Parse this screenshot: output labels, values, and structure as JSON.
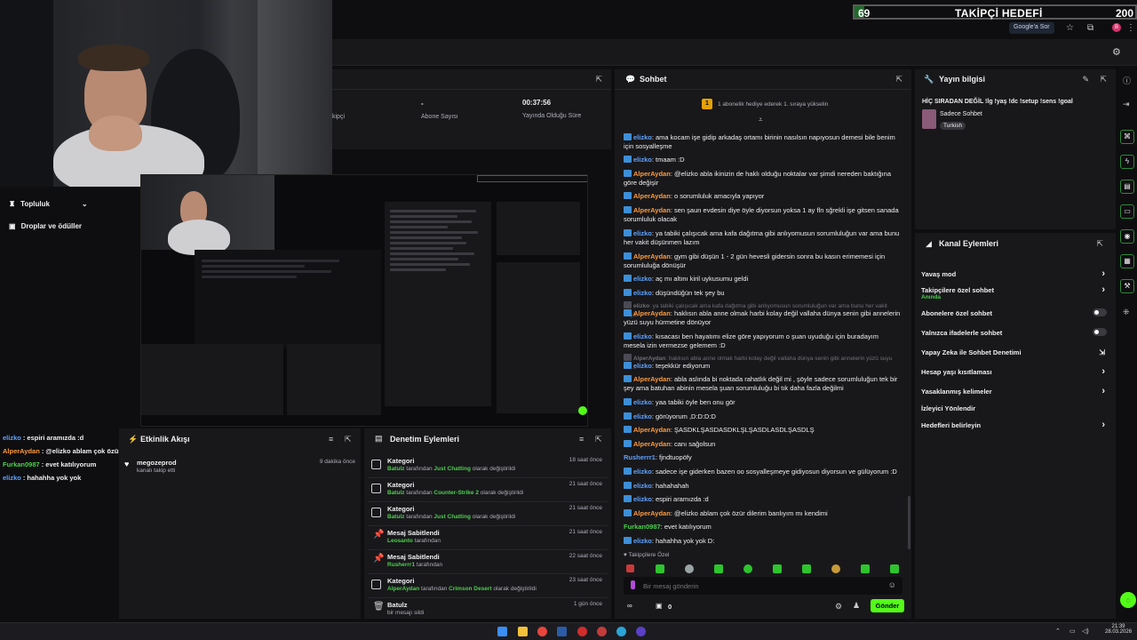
{
  "goal_bar": {
    "current": "69",
    "label": "TAKİPÇİ HEDEFİ",
    "target": "200"
  },
  "browser": {
    "search_chip": "Google'a Sor",
    "avatar_letter": "B"
  },
  "stats": {
    "col1_label": "kipçi",
    "col2_value": "-",
    "col2_label": "Abone Sayısı",
    "col3_value": "00:37:56",
    "col3_label": "Yayında Olduğu Süre"
  },
  "sidebar": {
    "items": [
      {
        "label": "Topluluk"
      },
      {
        "label": "Droplar ve ödüller"
      }
    ]
  },
  "overlay_chat": [
    {
      "user": "elizko",
      "color": "#5fa2ff",
      "text": ": espiri aramızda :d"
    },
    {
      "user": "AlperAydan",
      "color": "#ff9a3c",
      "text": ": @elizko ablam çok özür dilerim banlıyım mı kendimi"
    },
    {
      "user": "Furkan0987",
      "color": "#4bd14b",
      "text": ": evet katılıyorum"
    },
    {
      "user": "elizko",
      "color": "#5fa2ff",
      "text": ": hahahha yok yok"
    }
  ],
  "activity": {
    "title": "Etkinlik Akışı",
    "items": [
      {
        "user": "megozeprod",
        "desc": "kanalı takip etti",
        "time": "9 dakika önce"
      }
    ]
  },
  "mod": {
    "title": "Denetim Eylemleri",
    "rows": [
      {
        "title": "Kategori",
        "actor": "Batulz",
        "mid": " tarafından ",
        "value": "Just Chatting",
        "tail": " olarak değiştirildi",
        "time": "18 saat önce"
      },
      {
        "title": "Kategori",
        "actor": "Batulz",
        "mid": " tarafından ",
        "value": "Counter-Strike 2",
        "tail": " olarak değiştirildi",
        "time": "21 saat önce"
      },
      {
        "title": "Kategori",
        "actor": "Batulz",
        "mid": " tarafından ",
        "value": "Just Chatting",
        "tail": " olarak değiştirildi",
        "time": "21 saat önce"
      },
      {
        "title": "Mesaj Sabitlendi",
        "actor": "Leosanto",
        "mid": " tarafından",
        "value": "",
        "tail": "",
        "time": "21 saat önce"
      },
      {
        "title": "Mesaj Sabitlendi",
        "actor": "Rusherrr1",
        "mid": " tarafından",
        "value": "",
        "tail": "",
        "time": "22 saat önce"
      },
      {
        "title": "Kategori",
        "actor": "AlperAydan",
        "mid": " tarafından ",
        "value": "Crimson Desert",
        "tail": " olarak değiştirildi",
        "time": "23 saat önce"
      },
      {
        "title": "Batulz",
        "actor": "",
        "mid": "bir mesajı sildi",
        "value": "",
        "tail": "",
        "time": "1 gün önce"
      }
    ]
  },
  "chat": {
    "title": "Sohbet",
    "gift_banner": "1 abonelik hediye ederek 1. sıraya yükselin",
    "messages": [
      {
        "user": "elizko",
        "color": "#5fa2ff",
        "text": ": ama kocam işe gidip arkadaş ortamı birinin nasılsın napıyosun demesi bile benim için sosyalleşme"
      },
      {
        "user": "elizko",
        "color": "#5fa2ff",
        "text": ": tmaam :D"
      },
      {
        "user": "AlperAydan",
        "color": "#ff9a3c",
        "text": ": @elizko abla ikinizin de haklı olduğu noktalar var şimdi nereden baktığına göre değişir"
      },
      {
        "user": "AlperAydan",
        "color": "#ff9a3c",
        "text": ": o sorumluluk amacıyla yapıyor"
      },
      {
        "user": "AlperAydan",
        "color": "#ff9a3c",
        "text": ": sen şaun evdesin diye öyle diyorsun yoksa 1 ay fln sğrekli işe gitsen sanada sorumluluk olacak"
      },
      {
        "user": "elizko",
        "color": "#5fa2ff",
        "text": ": ya tabiki çalışıcak ama kafa dağıtma gibi anlıyomusun sorumluluğun var ama bunu her vakit düşünmen lazım"
      },
      {
        "user": "AlperAydan",
        "color": "#ff9a3c",
        "text": ": gym gibi düşün 1 - 2 gün hevesli gidersin sonra bu kasın erimemesi için sorumluluğa dönüşür"
      },
      {
        "user": "elizko",
        "color": "#5fa2ff",
        "text": ": aç mı altını kiril uykusumu geldi"
      },
      {
        "user": "elizko",
        "color": "#5fa2ff",
        "text": ": düşündüğün tek şey bu"
      },
      {
        "user": "elizko",
        "color": "#6f6f78",
        "text": ": ya tabiki çalışıcak ama kafa dağıtma gibi anlıyomusun sorumluluğun var ama bunu her vakit düşü...",
        "dim": true
      },
      {
        "user": "AlperAydan",
        "color": "#ff9a3c",
        "text": ": haklısın abla anne olmak harbi kolay değil vallaha dünya senin gibi annelerin yüzü suyu hürmetine dönüyor"
      },
      {
        "user": "elizko",
        "color": "#5fa2ff",
        "text": ": kısacası ben hayatımı elize göre yapıyorum o şuan uyuduğu için buradayım mesela izin vermezse gelemem :D"
      },
      {
        "user": "AlperAydan",
        "color": "#6f6f78",
        "text": ": haklısın abla anne olmak harbi kolay değil vallaha dünya senin gibi annelerin yüzü suyu hur...",
        "dim": true
      },
      {
        "user": "elizko",
        "color": "#5fa2ff",
        "text": ": teşekkür ediyorum"
      },
      {
        "user": "AlperAydan",
        "color": "#ff9a3c",
        "text": ": abla aslında bi noktada rahatlık değil mi , şöyle sadece sorumluluğun tek bir şey ama batuhan abinin mesela şuan sorumluluğu bi tık daha fazla değilmi"
      },
      {
        "user": "elizko",
        "color": "#5fa2ff",
        "text": ": yaa tabiki öyle ben onu gör"
      },
      {
        "user": "elizko",
        "color": "#5fa2ff",
        "text": ": görüyorum ,D:D:D:D"
      },
      {
        "user": "AlperAydan",
        "color": "#ff9a3c",
        "text": ": ŞASDKLŞASDASDKLŞLŞASDLASDLŞASDLŞ"
      },
      {
        "user": "AlperAydan",
        "color": "#ff9a3c",
        "text": ": canı sağolsun"
      },
      {
        "user": "Rusherrr1",
        "color": "#5fa2ff",
        "text": ": fjndtuopöfy"
      },
      {
        "user": "elizko",
        "color": "#5fa2ff",
        "text": ": sadece işe giderken bazen oo sosyalleşmeye gidiyosun diyorsun ve gülüyorum :D"
      },
      {
        "user": "elizko",
        "color": "#5fa2ff",
        "text": ": hahahahah"
      },
      {
        "user": "elizko",
        "color": "#5fa2ff",
        "text": ": espiri aramızda :d"
      },
      {
        "user": "AlperAydan",
        "color": "#ff9a3c",
        "text": ": @elizko ablam çok özür dilerim banlıyım mı kendimi"
      },
      {
        "user": "Furkan0987",
        "color": "#4bd14b",
        "text": ": evet katılıyorum"
      },
      {
        "user": "elizko",
        "color": "#5fa2ff",
        "text": ": hahahha yok yok D:"
      }
    ],
    "followers_only": "Takipçilere Özel",
    "input_placeholder": "Bir mesaj gönderin",
    "points": "0",
    "send_label": "Gönder"
  },
  "stream_info": {
    "title": "Yayın bilgisi",
    "stream_title": "HİÇ SIRADAN DEĞİL !lg !yaş !dc !setup !sens !goal",
    "category": "Sadece Sohbet",
    "language": "Turkish"
  },
  "channel_actions": {
    "title": "Kanal Eylemleri",
    "items": [
      {
        "label": "Yavaş mod",
        "sub": "",
        "control": "chevron"
      },
      {
        "label": "Takipçilere özel sohbet",
        "sub": "Anında",
        "control": "chevron"
      },
      {
        "label": "Abonelere özel sohbet",
        "sub": "",
        "control": "toggle"
      },
      {
        "label": "Yalnızca ifadelerle sohbet",
        "sub": "",
        "control": "toggle"
      },
      {
        "label": "Yapay Zeka ile Sohbet Denetimi",
        "sub": "",
        "control": "external"
      },
      {
        "label": "Hesap yaşı kısıtlaması",
        "sub": "",
        "control": "chevron"
      },
      {
        "label": "Yasaklanmış kelimeler",
        "sub": "",
        "control": "chevron"
      },
      {
        "label": "İzleyici Yönlendir",
        "sub": "",
        "control": "none"
      },
      {
        "label": "Hedefleri belirleyin",
        "sub": "",
        "control": "chevron"
      }
    ]
  },
  "clock": {
    "time": "21:39",
    "date": "28.03.2026"
  },
  "colors": {
    "accent_green": "#53fc18",
    "panel": "#18181b",
    "bg": "#0e0e10"
  }
}
